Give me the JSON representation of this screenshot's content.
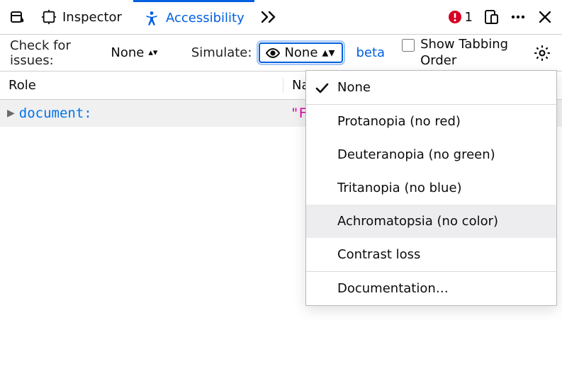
{
  "tabs": {
    "inspector": "Inspector",
    "accessibility": "Accessibility"
  },
  "error_count": "1",
  "options": {
    "check_label": "Check for issues:",
    "check_value": "None",
    "simulate_label": "Simulate:",
    "simulate_value": "None",
    "beta": "beta",
    "show_tabbing": "Show Tabbing Order"
  },
  "columns": {
    "role": "Role",
    "name": "Name"
  },
  "tree": {
    "role": "document:",
    "name_fragment": "\"F"
  },
  "menu": {
    "items": [
      "None",
      "Protanopia (no red)",
      "Deuteranopia (no green)",
      "Tritanopia (no blue)",
      "Achromatopsia (no color)",
      "Contrast loss",
      "Documentation…"
    ],
    "checked_index": 0,
    "hover_index": 4
  }
}
